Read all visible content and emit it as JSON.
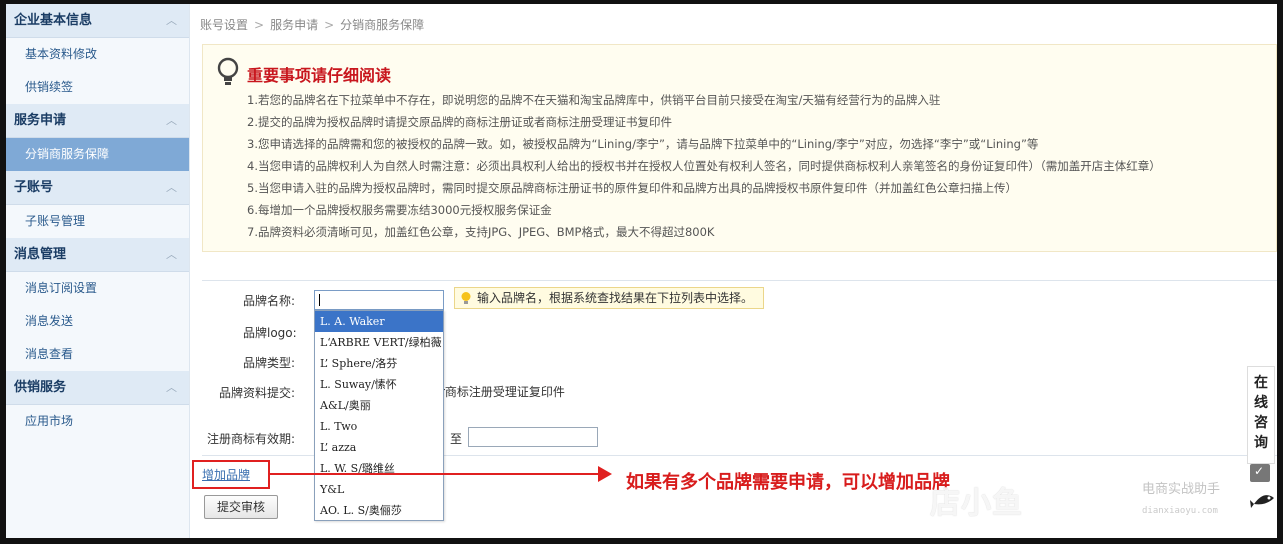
{
  "sidebar": {
    "groups": [
      {
        "title": "企业基本信息",
        "items": [
          "基本资料修改",
          "供销续签"
        ]
      },
      {
        "title": "服务申请",
        "items": [
          "分销商服务保障"
        ]
      },
      {
        "title": "子账号",
        "items": [
          "子账号管理"
        ]
      },
      {
        "title": "消息管理",
        "items": [
          "消息订阅设置",
          "消息发送",
          "消息查看"
        ]
      },
      {
        "title": "供销服务",
        "items": [
          "应用市场"
        ]
      }
    ],
    "active_item": "分销商服务保障",
    "collapse_glyph": "︿"
  },
  "breadcrumb": [
    "账号设置",
    "服务申请",
    "分销商服务保障"
  ],
  "breadcrumb_sep": ">",
  "notice": {
    "title": "重要事项请仔细阅读",
    "items": [
      "1.若您的品牌名在下拉菜单中不存在，即说明您的品牌不在天猫和淘宝品牌库中，供销平台目前只接受在淘宝/天猫有经营行为的品牌入驻",
      "2.提交的品牌为授权品牌时请提交原品牌的商标注册证或者商标注册受理证书复印件",
      "3.您申请选择的品牌需和您的被授权的品牌一致。如，被授权品牌为“Lining/李宁”，请与品牌下拉菜单中的“Lining/李宁”对应，勿选择“李宁”或“Lining”等",
      "4.当您申请的品牌权利人为自然人时需注意：必须出具权利人给出的授权书并在授权人位置处有权利人签名，同时提供商标权利人亲笔签名的身份证复印件）（需加盖开店主体红章）",
      "5.当您申请入驻的品牌为授权品牌时，需同时提交原品牌商标注册证书的原件复印件和品牌方出具的品牌授权书原件复印件（并加盖红色公章扫描上传）",
      "6.每增加一个品牌授权服务需要冻结3000元授权服务保证金",
      "7.品牌资料必须清晰可见，加盖红色公章，支持JPG、JPEG、BMP格式，最大不得超过800K"
    ]
  },
  "form": {
    "brand_name_label": "品牌名称:",
    "brand_name_value": "",
    "brand_logo_label": "品牌logo:",
    "brand_type_label": "品牌类型:",
    "brand_docs_label": "品牌资料提交:",
    "brand_docs_text": "r商标注册受理证复印件",
    "trademark_validity_label": "注册商标有效期:",
    "date_to_label": "至",
    "tip": "输入品牌名，根据系统查找结果在下拉列表中选择。",
    "dropdown_options": [
      "L. A. Wa​ker",
      "L‘ARBRE VERT/绿柏薇",
      "L’ Sphere/洛芬",
      "L. Suway/愫怀",
      "A&L/奥丽",
      "L. Two",
      "L’ azza",
      "L. W. S/璐维丝",
      "Y&L",
      "AO. L. S/奥俪莎"
    ],
    "dropdown_highlighted_index": 0,
    "add_brand_label": "增加品牌",
    "submit_label": "提交审核"
  },
  "annotation": "如果有多个品牌需要申请，可以增加品牌",
  "consult": {
    "label_chars": [
      "在",
      "线",
      "咨",
      "询"
    ]
  },
  "watermark": {
    "brand": "店小鱼",
    "tagline": "电商实战助手",
    "url": "dianxiaoyu.com"
  },
  "colors": {
    "accent_red": "#c8161d",
    "sidebar_active": "#7fa9d6",
    "link_blue": "#3a6fb0",
    "dropdown_highlight": "#3b74c8"
  }
}
